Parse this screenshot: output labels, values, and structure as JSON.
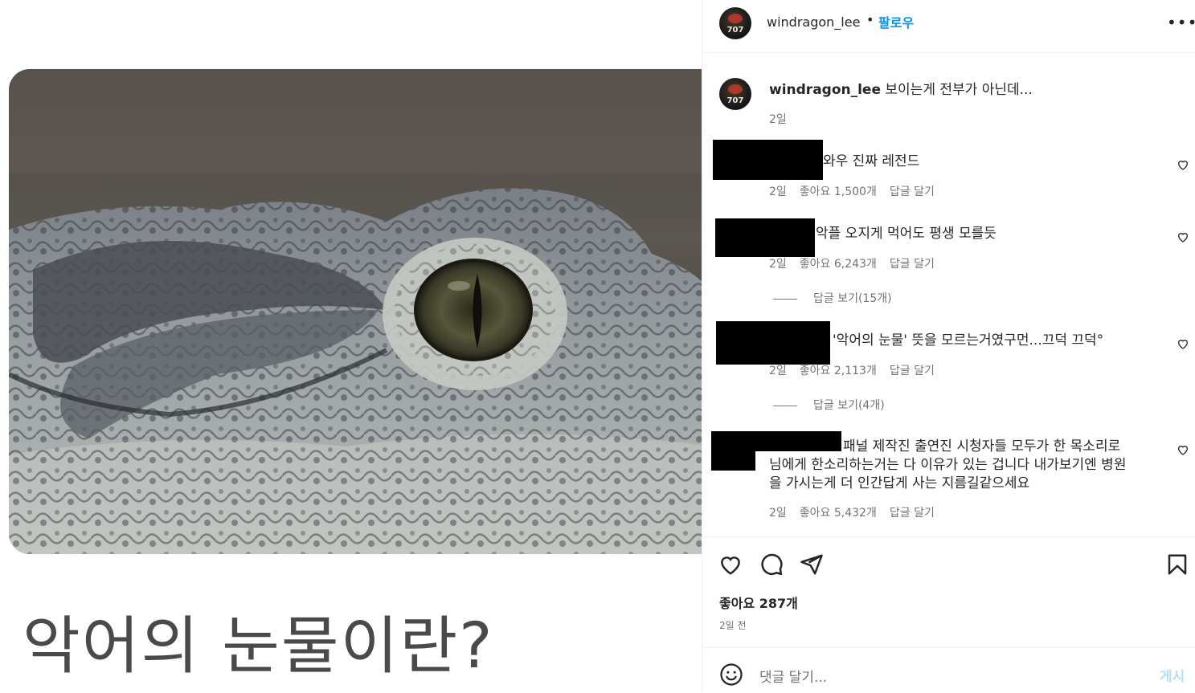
{
  "post": {
    "caption_overlay": "악어의 눈물이란?"
  },
  "header": {
    "username": "windragon_lee",
    "separator": "•",
    "follow_label": "팔로우",
    "avatar_text": "707"
  },
  "owner_comment": {
    "username": "windragon_lee",
    "text": "보이는게 전부가 아닌데...",
    "time": "2일"
  },
  "comments": [
    {
      "text": "와우 진짜 레전드",
      "time": "2일",
      "likes": "좋아요 1,500개",
      "reply": "답글 달기"
    },
    {
      "text": "악플 오지게 먹어도 평생 모를듯",
      "time": "2일",
      "likes": "좋아요 6,243개",
      "reply": "답글 달기",
      "view_replies": "답글 보기(15개)"
    },
    {
      "text": "'악어의 눈물' 뜻을 모르는거였구먼...끄덕 끄덕°",
      "time": "2일",
      "likes": "좋아요 2,113개",
      "reply": "답글 달기",
      "view_replies": "답글 보기(4개)"
    },
    {
      "text_line1": "패널 제작진 출연진 시청자들 모두가 한 목소리로",
      "text_line2": "님에게 한소리하는거는 다 이유가 있는 겁니다 내가보기엔 병원",
      "text_line3": "을 가시는게 더 인간답게 사는 지름길같으세요",
      "time": "2일",
      "likes": "좋아요 5,432개",
      "reply": "답글 달기"
    }
  ],
  "footer": {
    "likes": "좋아요 287개",
    "when": "2일 전",
    "comment_placeholder": "댓글 달기...",
    "post_label": "게시"
  },
  "icons": [
    "heart-icon",
    "comment-icon",
    "share-icon",
    "bookmark-icon",
    "emoji-icon",
    "more-icon"
  ],
  "colors": {
    "accent": "#0095f6",
    "muted": "#737373",
    "text": "#262626"
  }
}
